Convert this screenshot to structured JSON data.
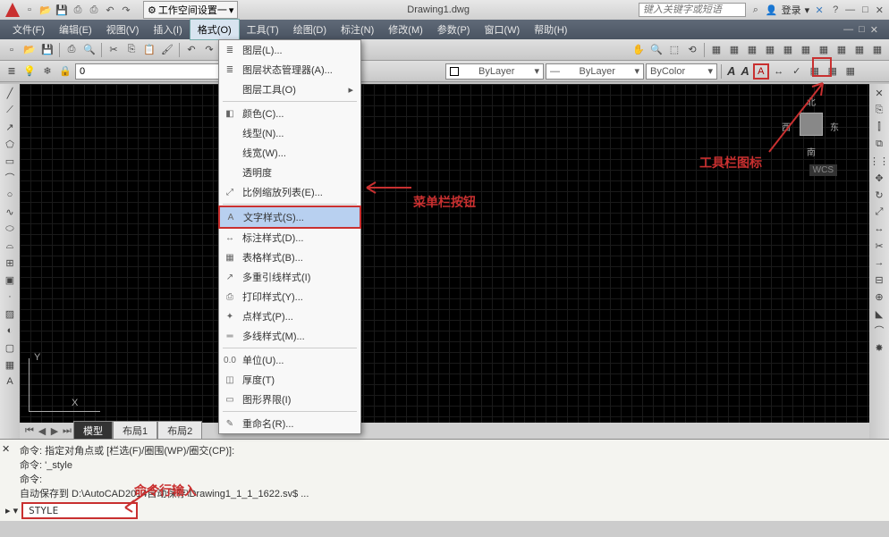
{
  "title": "Drawing1.dwg",
  "workspace": "工作空间设置一",
  "search_placeholder": "键入关键字或短语",
  "login_text": "登录",
  "menubar": [
    {
      "label": "文件(F)"
    },
    {
      "label": "编辑(E)"
    },
    {
      "label": "视图(V)"
    },
    {
      "label": "插入(I)"
    },
    {
      "label": "格式(O)"
    },
    {
      "label": "工具(T)"
    },
    {
      "label": "绘图(D)"
    },
    {
      "label": "标注(N)"
    },
    {
      "label": "修改(M)"
    },
    {
      "label": "参数(P)"
    },
    {
      "label": "窗口(W)"
    },
    {
      "label": "帮助(H)"
    }
  ],
  "dropdown": {
    "items": [
      {
        "label": "图层(L)..."
      },
      {
        "label": "图层状态管理器(A)..."
      },
      {
        "label": "图层工具(O)",
        "submenu": true
      },
      {
        "label": "颜色(C)..."
      },
      {
        "label": "线型(N)..."
      },
      {
        "label": "线宽(W)..."
      },
      {
        "label": "透明度"
      },
      {
        "label": "比例缩放列表(E)..."
      },
      {
        "label": "文字样式(S)...",
        "highlighted": true
      },
      {
        "label": "标注样式(D)..."
      },
      {
        "label": "表格样式(B)..."
      },
      {
        "label": "多重引线样式(I)"
      },
      {
        "label": "打印样式(Y)..."
      },
      {
        "label": "点样式(P)..."
      },
      {
        "label": "多线样式(M)..."
      },
      {
        "label": "单位(U)..."
      },
      {
        "label": "厚度(T)"
      },
      {
        "label": "图形界限(I)"
      },
      {
        "label": "重命名(R)..."
      }
    ]
  },
  "properties": {
    "color": "ByLayer",
    "linetype": "ByLayer",
    "plot": "ByColor"
  },
  "layer_current": "0",
  "viewcube": {
    "n": "北",
    "s": "南",
    "e": "东",
    "w": "西"
  },
  "wcs": "WCS",
  "ucs": {
    "x": "X",
    "y": "Y"
  },
  "tabs": [
    {
      "label": "模型",
      "active": true
    },
    {
      "label": "布局1"
    },
    {
      "label": "布局2"
    }
  ],
  "command_history": [
    "命令: 指定对角点或 [栏选(F)/圈围(WP)/圈交(CP)]:",
    "命令: '_style",
    "命令:",
    "自动保存到 D:\\AutoCAD2014自动保存\\Drawing1_1_1_1622.sv$ ..."
  ],
  "command_input": "STYLE",
  "command_prompt": "▸ ▾",
  "annotations": {
    "menu_button": "菜单栏按钮",
    "toolbar_icon": "工具栏图标",
    "cmd_input": "命令行输入"
  }
}
